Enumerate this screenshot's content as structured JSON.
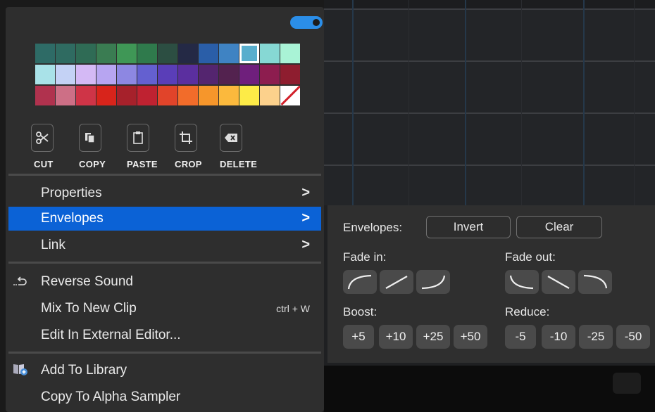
{
  "toggle": {
    "state": "on",
    "color": "#2b8ee8"
  },
  "palette": {
    "rows": [
      [
        "#2e6b66",
        "#2f6b61",
        "#2f6b55",
        "#3a7c52",
        "#3f9756",
        "#2f7a4c",
        "#2c4e42",
        "#242945",
        "#2a5ea8",
        "#3f83c3",
        "#58aecd",
        "#86d8d4",
        "#a9f3d6"
      ],
      [
        "#a9e2e8",
        "#c4d2f5",
        "#d4b9f5",
        "#b7a5f1",
        "#8d87e2",
        "#6460d0",
        "#5a3eb8",
        "#5b2f9f",
        "#54256f",
        "#53224f",
        "#6f1f7c",
        "#8d1d4f",
        "#8e1d2f"
      ],
      [
        "#b0324e",
        "#cd6f86",
        "#cf3447",
        "#d8241b",
        "#a6212b",
        "#bf2231",
        "#e1442a",
        "#f26c2a",
        "#f6962b",
        "#fbb93d",
        "#fdeb47",
        "#fcd18c",
        "none"
      ]
    ],
    "selected": "#58aecd"
  },
  "tools": [
    {
      "label": "CUT",
      "icon": "scissors-icon"
    },
    {
      "label": "COPY",
      "icon": "copy-icon"
    },
    {
      "label": "PASTE",
      "icon": "clipboard-icon"
    },
    {
      "label": "CROP",
      "icon": "crop-icon"
    },
    {
      "label": "DELETE",
      "icon": "backspace-icon"
    }
  ],
  "menu": {
    "properties": "Properties",
    "envelopes": "Envelopes",
    "link": "Link",
    "reverse_sound": "Reverse Sound",
    "mix_to_new_clip": "Mix To New Clip",
    "mix_shortcut": "ctrl + W",
    "edit_external": "Edit In External Editor...",
    "add_to_library": "Add To Library",
    "copy_to_alpha": "Copy To Alpha Sampler",
    "arrow": ">",
    "active_color": "#0b62d6"
  },
  "envelopes_panel": {
    "title": "Envelopes:",
    "invert": "Invert",
    "clear": "Clear",
    "fade_in": "Fade in:",
    "fade_out": "Fade out:",
    "boost": "Boost:",
    "reduce": "Reduce:",
    "boost_values": [
      "+5",
      "+10",
      "+25",
      "+50"
    ],
    "reduce_values": [
      "-5",
      "-10",
      "-25",
      "-50"
    ],
    "fade_in_curves": [
      "fade-in-convex-icon",
      "fade-in-linear-icon",
      "fade-in-concave-icon"
    ],
    "fade_out_curves": [
      "fade-out-concave-icon",
      "fade-out-linear-icon",
      "fade-out-convex-icon"
    ]
  }
}
